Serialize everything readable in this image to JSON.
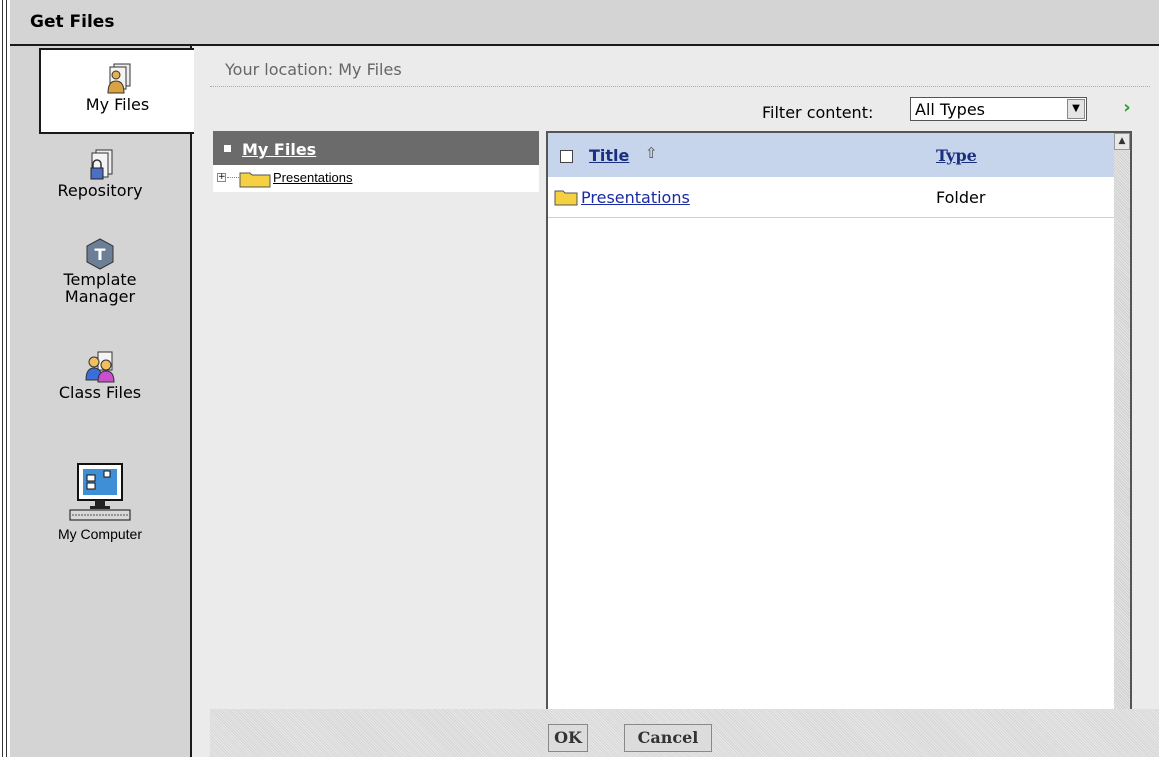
{
  "window": {
    "title": "Get Files"
  },
  "sidebar": {
    "items": [
      {
        "label": "My Files",
        "icon": "user-document-icon",
        "active": true
      },
      {
        "label": "Repository",
        "icon": "locked-document-icon",
        "active": false
      },
      {
        "label_line1": "Template",
        "label_line2": "Manager",
        "icon": "template-manager-icon",
        "active": false
      },
      {
        "label": "Class Files",
        "icon": "class-users-icon",
        "active": false
      },
      {
        "label": "My Computer",
        "icon": "computer-icon",
        "active": false
      }
    ]
  },
  "location": {
    "text": "Your location: My Files"
  },
  "filter": {
    "label": "Filter content:",
    "selected": "All Types"
  },
  "tree": {
    "root": "My Files",
    "children": [
      {
        "name": "Presentations"
      }
    ]
  },
  "list": {
    "columns": {
      "title": "Title",
      "type": "Type"
    },
    "sort_indicator": "⇧",
    "rows": [
      {
        "name": "Presentations",
        "type": "Folder"
      }
    ]
  },
  "buttons": {
    "ok": "OK",
    "cancel": "Cancel"
  },
  "colors": {
    "accent_header": "#c6d5ec",
    "link": "#1a2aa0",
    "tree_header": "#6b6b6b",
    "folder": "#f5d142",
    "go_arrow": "#2a9a2a"
  }
}
